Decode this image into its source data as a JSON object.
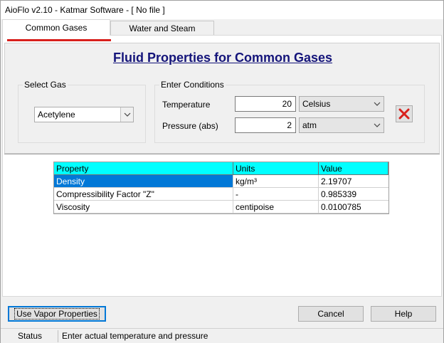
{
  "window": {
    "title": "AioFlo  v2.10  -  Katmar Software  -  [ No file ]"
  },
  "tabs": [
    {
      "label": "Common Gases",
      "active": true
    },
    {
      "label": "Water and Steam",
      "active": false
    }
  ],
  "heading": "Fluid Properties for Common Gases",
  "select_gas": {
    "group_label": "Select Gas",
    "value": "Acetylene"
  },
  "conditions": {
    "group_label": "Enter Conditions",
    "temperature": {
      "label": "Temperature",
      "value": "20",
      "unit": "Celsius"
    },
    "pressure": {
      "label": "Pressure (abs)",
      "value": "2",
      "unit": "atm"
    }
  },
  "grid": {
    "headers": [
      "Property",
      "Units",
      "Value"
    ],
    "rows": [
      {
        "property": "Density",
        "units": "kg/m³",
        "value": "2.19707",
        "selected": true
      },
      {
        "property": "Compressibility Factor \"Z\"",
        "units": "-",
        "value": "0.985339",
        "selected": false
      },
      {
        "property": "Viscosity",
        "units": "centipoise",
        "value": "0.0100785",
        "selected": false
      }
    ]
  },
  "buttons": {
    "vapor": "Use Vapor Properties",
    "cancel": "Cancel",
    "help": "Help"
  },
  "statusbar": {
    "label": "Status",
    "message": "Enter actual temperature and pressure"
  },
  "colors": {
    "heading": "#14147a",
    "grid_header": "#00ffff",
    "selection": "#0078d7",
    "clear_icon": "#d8201c"
  },
  "icons": {
    "dropdown": "chevron-down-icon",
    "clear": "red-x-icon"
  }
}
